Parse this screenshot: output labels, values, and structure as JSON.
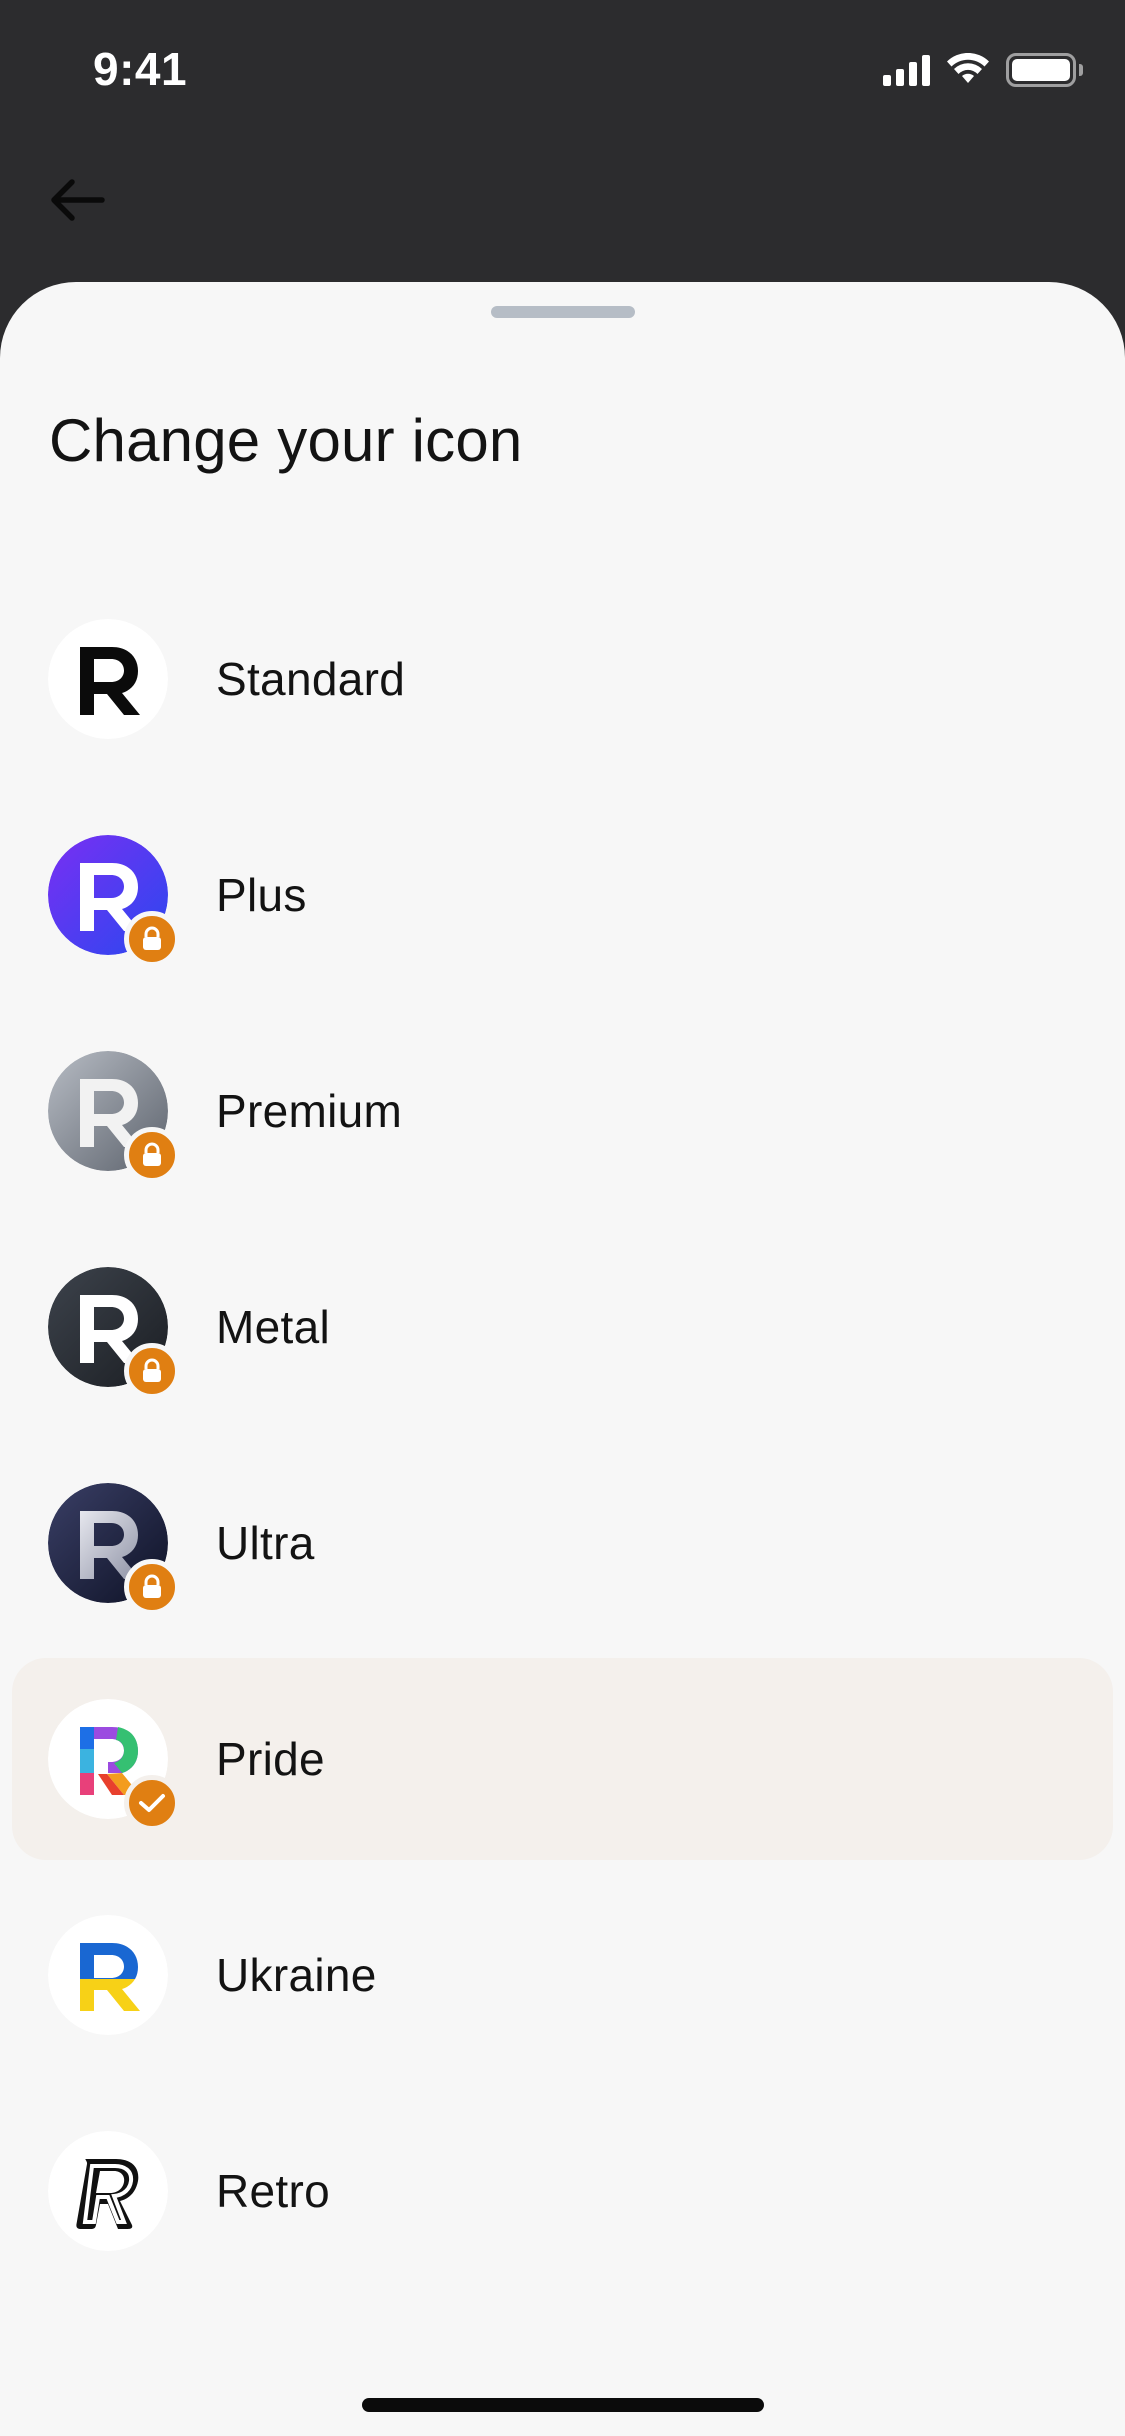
{
  "status_bar": {
    "time": "9:41"
  },
  "sheet": {
    "title": "Change your icon",
    "accent_color": "#e07f12",
    "items": [
      {
        "label": "Standard",
        "style": "standard",
        "status": "none"
      },
      {
        "label": "Plus",
        "style": "plus",
        "status": "locked"
      },
      {
        "label": "Premium",
        "style": "premium",
        "status": "locked"
      },
      {
        "label": "Metal",
        "style": "metal",
        "status": "locked"
      },
      {
        "label": "Ultra",
        "style": "ultra",
        "status": "locked"
      },
      {
        "label": "Pride",
        "style": "pride",
        "status": "selected"
      },
      {
        "label": "Ukraine",
        "style": "ukraine",
        "status": "none"
      },
      {
        "label": "Retro",
        "style": "retro",
        "status": "none"
      }
    ]
  }
}
